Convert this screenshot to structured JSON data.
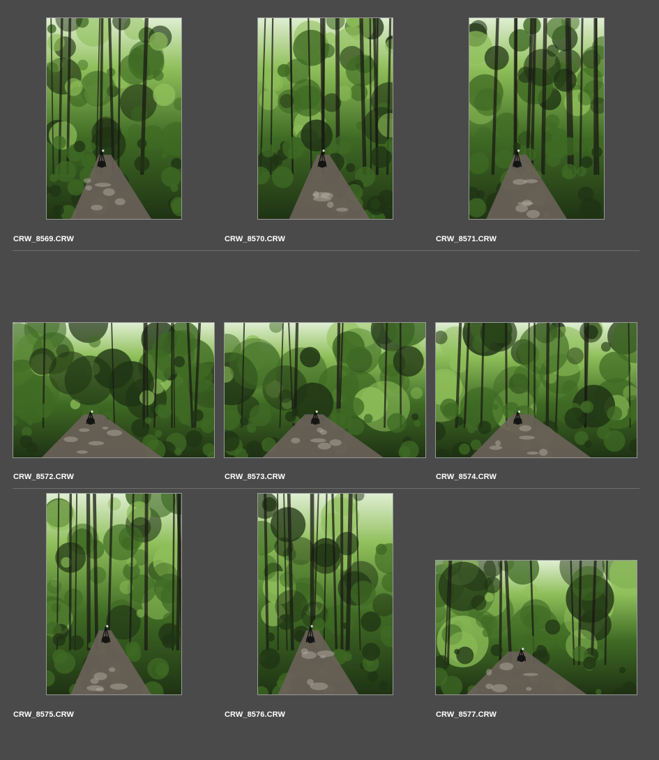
{
  "browser": {
    "rows": [
      {
        "items": [
          {
            "filename": "CRW_8569.CRW",
            "orientation": "portrait",
            "icon": "forest-photo-thumbnail"
          },
          {
            "filename": "CRW_8570.CRW",
            "orientation": "portrait",
            "icon": "forest-photo-thumbnail"
          },
          {
            "filename": "CRW_8571.CRW",
            "orientation": "portrait",
            "icon": "forest-photo-thumbnail"
          }
        ]
      },
      {
        "items": [
          {
            "filename": "CRW_8572.CRW",
            "orientation": "landscape",
            "icon": "forest-photo-thumbnail"
          },
          {
            "filename": "CRW_8573.CRW",
            "orientation": "landscape",
            "icon": "forest-photo-thumbnail"
          },
          {
            "filename": "CRW_8574.CRW",
            "orientation": "landscape",
            "icon": "forest-photo-thumbnail"
          }
        ]
      },
      {
        "items": [
          {
            "filename": "CRW_8575.CRW",
            "orientation": "portrait",
            "icon": "forest-photo-thumbnail"
          },
          {
            "filename": "CRW_8576.CRW",
            "orientation": "portrait",
            "icon": "forest-photo-thumbnail"
          },
          {
            "filename": "CRW_8577.CRW",
            "orientation": "landscape",
            "icon": "forest-photo-thumbnail"
          }
        ]
      }
    ]
  },
  "colors": {
    "background": "#4a4a4a",
    "caption_text": "#ffffff",
    "thumb_border": "#9a9a9a",
    "divider": "#6e6e6e",
    "foliage_dark": "#1f3314",
    "foliage_mid": "#3f6a24",
    "foliage_light": "#8fbf5a",
    "sky": "#dfeed2",
    "path": "#6b625a",
    "trunk": "#1a1a14"
  }
}
